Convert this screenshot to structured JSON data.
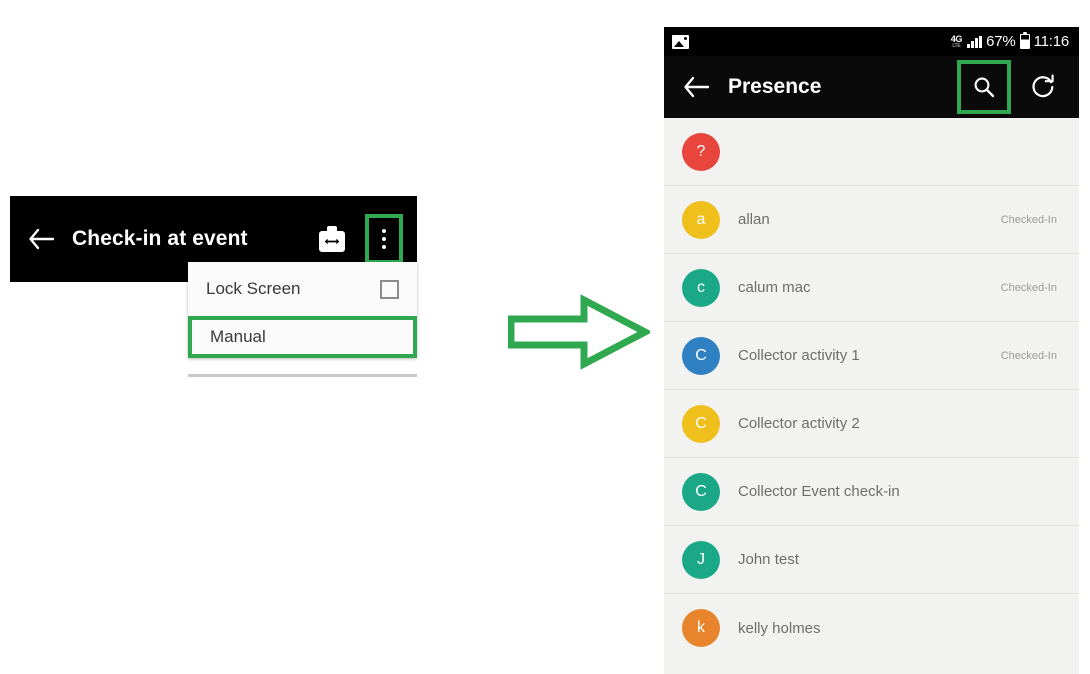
{
  "left_phone": {
    "appbar": {
      "back_icon": "arrow-back-icon",
      "title": "Check-in at event",
      "swap_icon": "swap-badge-icon",
      "overflow_icon": "overflow-menu-icon"
    },
    "menu": {
      "items": [
        {
          "label": "Lock Screen",
          "has_checkbox": true,
          "checked": false,
          "highlighted": false
        },
        {
          "label": "Manual",
          "has_checkbox": false,
          "checked": false,
          "highlighted": true
        }
      ]
    }
  },
  "flow": {
    "arrow_icon": "arrow-right-icon",
    "arrow_color": "#2FA84F"
  },
  "right_phone": {
    "status_bar": {
      "photo_icon": "photo-icon",
      "network_type": "4G",
      "network_sub": "LTE",
      "signal_icon": "signal-bars-icon",
      "battery_percent": "67%",
      "battery_icon": "battery-icon",
      "clock": "11:16"
    },
    "appbar": {
      "back_icon": "arrow-back-icon",
      "title": "Presence",
      "search_icon": "search-icon",
      "refresh_icon": "refresh-icon"
    },
    "people": [
      {
        "initial": "?",
        "color": "#E8453C",
        "name": "",
        "status": ""
      },
      {
        "initial": "a",
        "color": "#EFC01C",
        "name": "allan",
        "status": "Checked-In"
      },
      {
        "initial": "c",
        "color": "#1BA887",
        "name": "calum mac",
        "status": "Checked-In"
      },
      {
        "initial": "C",
        "color": "#3081C4",
        "name": "Collector activity 1",
        "status": "Checked-In"
      },
      {
        "initial": "C",
        "color": "#EFC01C",
        "name": "Collector activity 2",
        "status": ""
      },
      {
        "initial": "C",
        "color": "#1BA887",
        "name": "Collector Event check-in",
        "status": ""
      },
      {
        "initial": "J",
        "color": "#1BA887",
        "name": "John test",
        "status": ""
      },
      {
        "initial": "k",
        "color": "#E8842C",
        "name": "kelly holmes",
        "status": ""
      }
    ]
  },
  "highlight_color": "#2FA84F"
}
